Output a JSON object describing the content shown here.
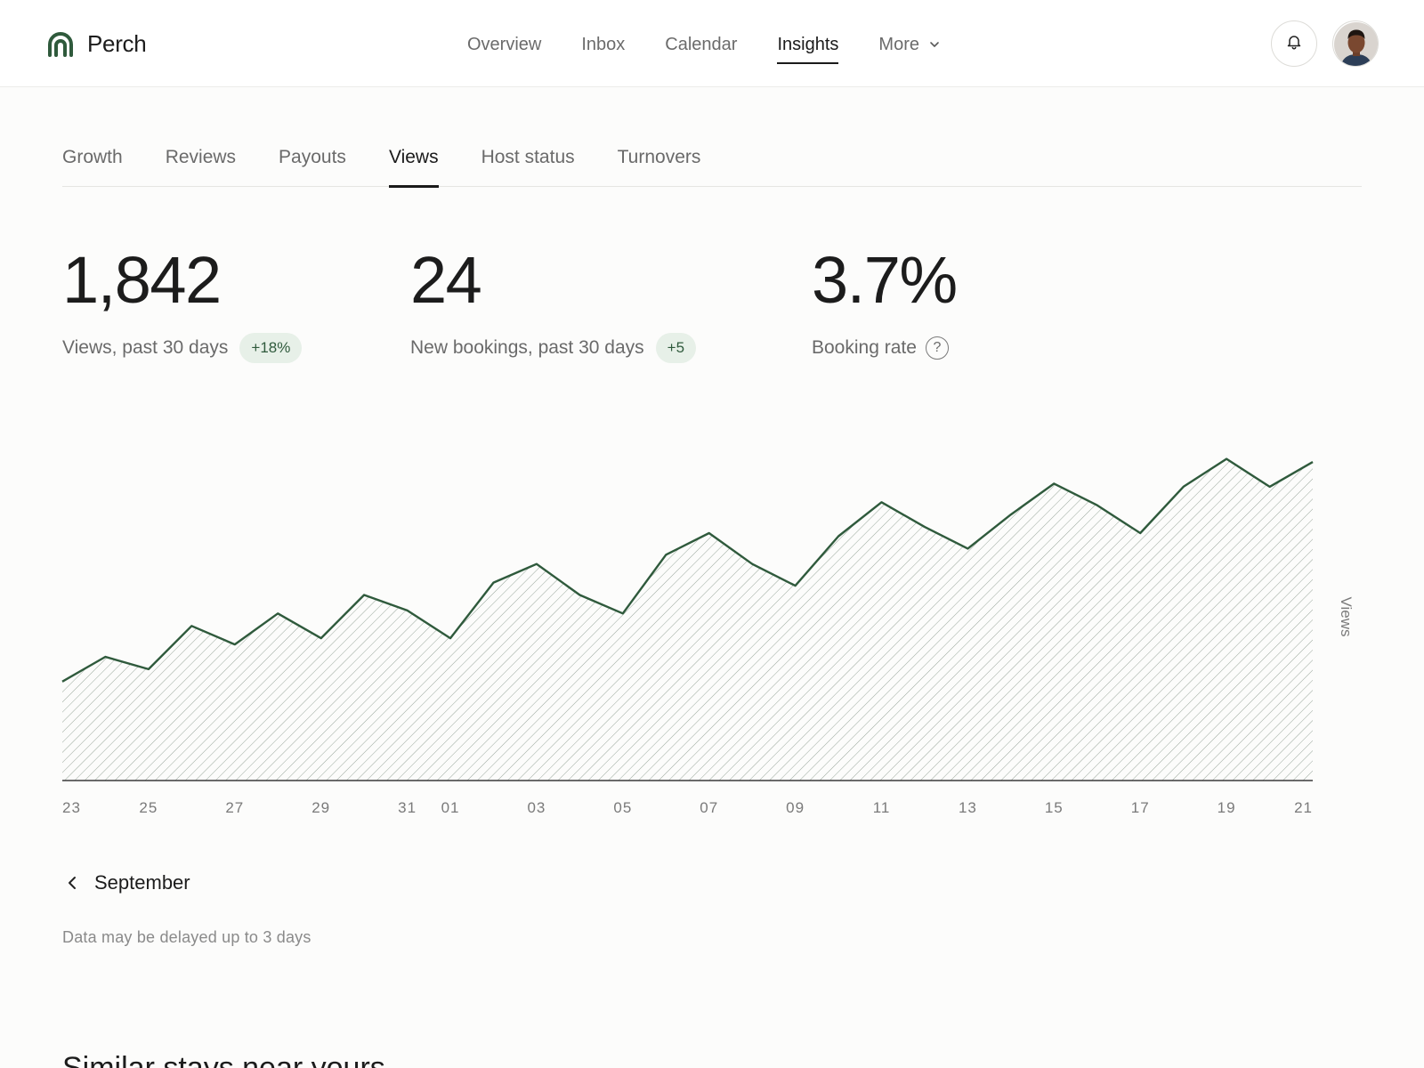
{
  "brand": {
    "name": "Perch",
    "accent": "#2f5a3c"
  },
  "nav": {
    "items": [
      {
        "label": "Overview",
        "active": false
      },
      {
        "label": "Inbox",
        "active": false
      },
      {
        "label": "Calendar",
        "active": false
      },
      {
        "label": "Insights",
        "active": true
      }
    ],
    "more_label": "More"
  },
  "header": {
    "bell_icon": "bell-icon",
    "avatar": "user-avatar"
  },
  "subtabs": [
    {
      "label": "Growth",
      "active": false
    },
    {
      "label": "Reviews",
      "active": false
    },
    {
      "label": "Payouts",
      "active": false
    },
    {
      "label": "Views",
      "active": true
    },
    {
      "label": "Host status",
      "active": false
    },
    {
      "label": "Turnovers",
      "active": false
    }
  ],
  "stats": {
    "views": {
      "value": "1,842",
      "label": "Views, past 30 days",
      "badge": "+18%"
    },
    "bookings": {
      "value": "24",
      "label": "New bookings, past 30 days",
      "badge": "+5"
    },
    "rate": {
      "value": "3.7%",
      "label": "Booking rate",
      "help": "?"
    }
  },
  "chart_data": {
    "type": "area",
    "ylabel": "Views",
    "x": [
      "23",
      "24",
      "25",
      "26",
      "27",
      "28",
      "29",
      "30",
      "31",
      "01",
      "02",
      "03",
      "04",
      "05",
      "06",
      "07",
      "08",
      "09",
      "10",
      "11",
      "12",
      "13",
      "14",
      "15",
      "16",
      "17",
      "18",
      "19",
      "20",
      "21"
    ],
    "tick_labels": [
      "23",
      "25",
      "27",
      "29",
      "31",
      "01",
      "03",
      "05",
      "07",
      "09",
      "11",
      "13",
      "15",
      "17",
      "19",
      "21"
    ],
    "values": [
      32,
      40,
      36,
      50,
      44,
      54,
      46,
      60,
      55,
      46,
      64,
      70,
      60,
      54,
      73,
      80,
      70,
      63,
      79,
      90,
      82,
      75,
      86,
      96,
      89,
      80,
      95,
      104,
      95,
      103
    ],
    "ylim": [
      0,
      120
    ],
    "line_color": "#2f5a3c",
    "fill": "hatched"
  },
  "footer": {
    "month_label": "September",
    "note": "Data may be delayed up to 3 days",
    "section_title": "Similar stays near yours"
  }
}
